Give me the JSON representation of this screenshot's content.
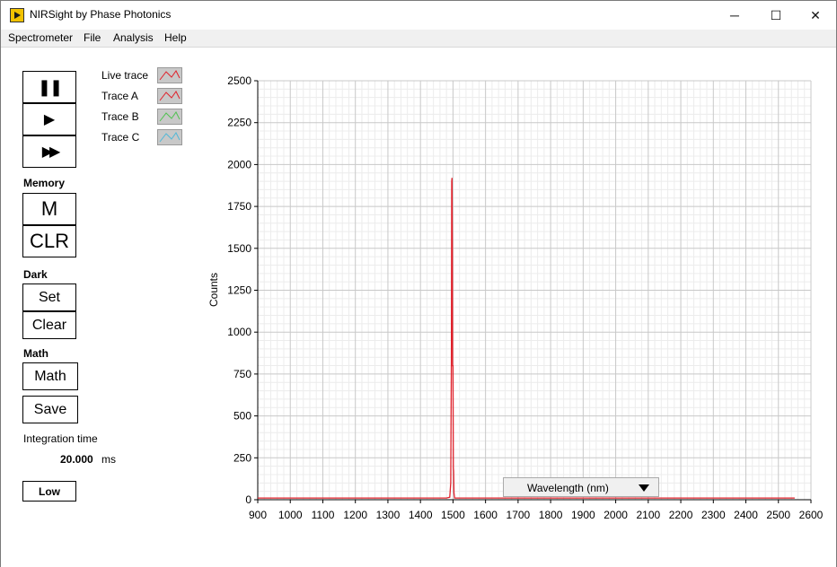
{
  "window": {
    "title": "NIRSight by Phase Photonics",
    "minimize_glyph": "─",
    "maximize_glyph": "☐",
    "close_glyph": "✕"
  },
  "menu": [
    "Spectrometer",
    "File",
    "Analysis",
    "Help"
  ],
  "controls": {
    "pause_glyph": "❚❚",
    "play_glyph": "▶",
    "fast_glyph": "▶▶",
    "memory_label": "Memory",
    "memory_m": "M",
    "memory_clr": "CLR",
    "dark_label": "Dark",
    "dark_set": "Set",
    "dark_clear": "Clear",
    "math_label": "Math",
    "math_button": "Math",
    "save_button": "Save",
    "integration_label": "Integration time",
    "integration_value": "20.000",
    "integration_unit": "ms",
    "gain_button": "Low"
  },
  "legend": [
    {
      "name": "Live trace",
      "color": "#e0202a"
    },
    {
      "name": "Trace A",
      "color": "#e0202a"
    },
    {
      "name": "Trace B",
      "color": "#4fc24f"
    },
    {
      "name": "Trace C",
      "color": "#4fb8d8"
    }
  ],
  "x_axis_selector": {
    "label": "Wavelength (nm)"
  },
  "chart_data": {
    "type": "line",
    "ylabel": "Counts",
    "xlabel": "Wavelength (nm)",
    "xlim": [
      900,
      2600
    ],
    "ylim": [
      0,
      2500
    ],
    "x_ticks": [
      900,
      1000,
      1100,
      1200,
      1300,
      1400,
      1500,
      1600,
      1700,
      1800,
      1900,
      2000,
      2100,
      2200,
      2300,
      2400,
      2500,
      2600
    ],
    "y_ticks": [
      0,
      250,
      500,
      750,
      1000,
      1250,
      1500,
      1750,
      2000,
      2250,
      2500
    ],
    "grid": true,
    "series": [
      {
        "color": "#e0202a",
        "x": [
          900,
          1000,
          1100,
          1200,
          1300,
          1400,
          1480,
          1490,
          1493,
          1495,
          1496,
          1497,
          1498,
          1499,
          1500,
          1501,
          1502,
          1503,
          1505,
          1520,
          1600,
          1800,
          2000,
          2200,
          2400,
          2550
        ],
        "y": [
          10,
          10,
          10,
          10,
          10,
          10,
          10,
          15,
          100,
          830,
          1900,
          1920,
          1500,
          800,
          800,
          190,
          170,
          40,
          10,
          10,
          10,
          10,
          10,
          10,
          10,
          10
        ]
      }
    ]
  }
}
